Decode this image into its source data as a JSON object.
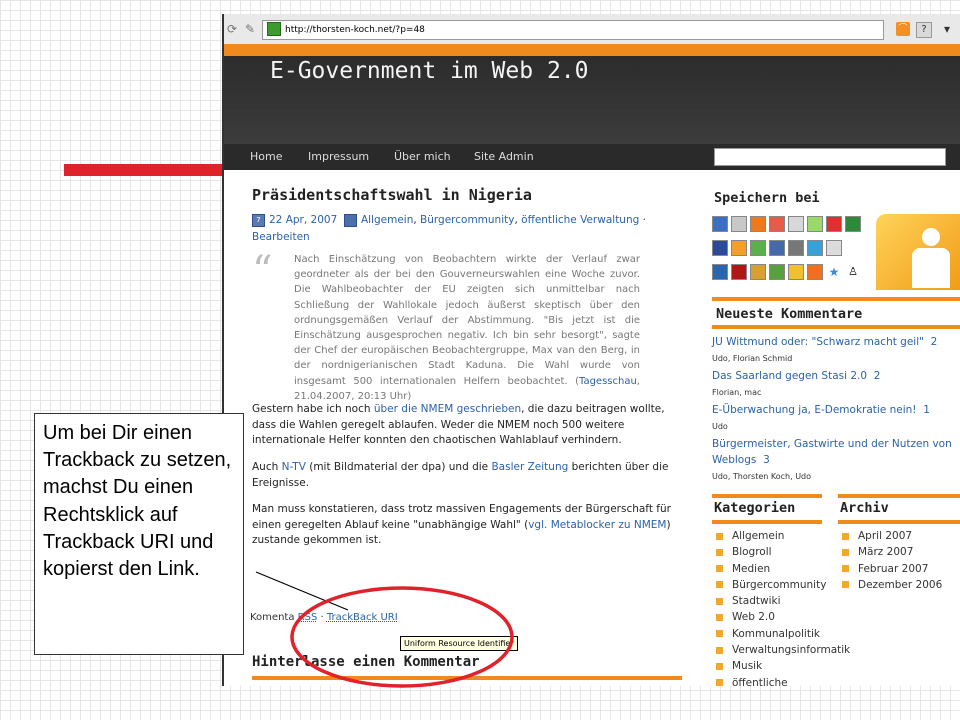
{
  "browser": {
    "url": "http://thorsten-koch.net/?p=48"
  },
  "site": {
    "title": "E-Government im Web 2.0",
    "menu": [
      "Home",
      "Impressum",
      "Über mich",
      "Site Admin"
    ]
  },
  "post": {
    "title": "Präsidentschaftswahl in Nigeria",
    "date": "22 Apr, 2007",
    "categories": [
      "Allgemein",
      "Bürgercommunity",
      "öffentliche Verwaltung"
    ],
    "edit_label": "Bearbeiten",
    "quote": "Nach Einschätzung von Beobachtern wirkte der Verlauf zwar geordneter als der bei den Gouverneurswahlen eine Woche zuvor. Die Wahlbeobachter der EU zeigten sich unmittelbar nach Schließung der Wahllokale jedoch äußerst skeptisch über den ordnungsgemäßen Verlauf der Abstimmung. \"Bis jetzt ist die Einschätzung ausgesprochen negativ. Ich bin sehr besorgt\", sagte der Chef der europäischen Beobachtergruppe, Max van den Berg, in der nordnigerianischen Stadt Kaduna. Die Wahl wurde von insgesamt 500 internationalen Helfern beobachtet.",
    "quote_source_link": "Tagesschau",
    "quote_source_date": ", 21.04.2007, 20:13 Uhr)",
    "p1_a": "Gestern habe ich noch ",
    "p1_link": "über die NMEM geschrieben",
    "p1_b": ", die dazu beitragen wollte, dass die Wahlen geregelt ablaufen. Weder die NMEM noch 500 weitere internationale Helfer konnten den chaotischen Wahlablauf verhindern.",
    "p2_a": "Auch ",
    "p2_link1": "N-TV",
    "p2_b": " (mit Bildmaterial der dpa) und die ",
    "p2_link2": "Basler Zeitung",
    "p2_c": " berichten über die Ereignisse.",
    "p3_a": "Man muss konstatieren, dass trotz massiven Engagements der Bürgerschaft für einen geregelten Ablauf keine \"unabhängige Wahl\" (",
    "p3_link1": "vgl.",
    "p3_link2": "Metablocker zu NMEM",
    "p3_b": ") zustande gekommen ist.",
    "comment_prefix": "Komenta",
    "rss_label": "RSS",
    "trackback_label": "TrackBack URI",
    "tooltip": "Uniform Resource Identifier",
    "leave_comment_title": "Hinterlasse einen Kommentar"
  },
  "sidebar": {
    "bookmark_title": "Speichern bei",
    "recent_title": "Neueste Kommentare",
    "recent": [
      {
        "title": "JU Wittmund oder: \"Schwarz macht geil\"",
        "count": "2",
        "by": "Udo, Florian Schmid"
      },
      {
        "title": "Das Saarland gegen Stasi 2.0",
        "count": "2",
        "by": "Florian, mac"
      },
      {
        "title": "E-Überwachung ja, E-Demokratie nein!",
        "count": "1",
        "by": "Udo"
      },
      {
        "title": "Bürgermeister, Gastwirte und der Nutzen von Weblogs",
        "count": "3",
        "by": "Udo, Thorsten Koch, Udo"
      }
    ],
    "categories_title": "Kategorien",
    "categories": [
      "Allgemein",
      "Blogroll",
      "Medien",
      "Bürgercommunity",
      "Stadtwiki",
      "Web 2.0",
      "Kommunalpolitik",
      "Verwaltungsinformatik",
      "Musik",
      "öffentliche"
    ],
    "archive_title": "Archiv",
    "archive": [
      "April 2007",
      "März 2007",
      "Februar 2007",
      "Dezember 2006"
    ]
  },
  "annotation": {
    "text": "Um bei Dir einen Trackback zu setzen, machst Du einen Rechtsklick auf Trackback URI und kopierst den Link."
  },
  "colors": {
    "accent": "#f08a1c",
    "slide_bar": "#e0232b",
    "link": "#2a62a8",
    "highlight_ellipse": "#e0232b"
  }
}
